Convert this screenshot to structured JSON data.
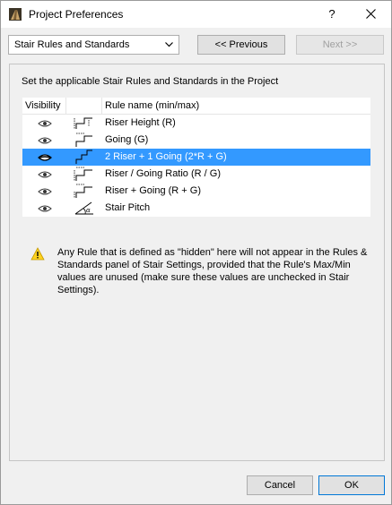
{
  "window": {
    "title": "Project Preferences",
    "help": "?",
    "close": "✕"
  },
  "toolbar": {
    "section": "Stair Rules and Standards",
    "prev_label": "<< Previous",
    "next_label": "Next >>"
  },
  "panel": {
    "heading": "Set the applicable Stair Rules and Standards in the Project",
    "columns": {
      "visibility": "Visibility",
      "name": "Rule name (min/max)"
    },
    "rows": [
      {
        "label": "Riser Height (R)",
        "selected": false
      },
      {
        "label": "Going (G)",
        "selected": false
      },
      {
        "label": "2 Riser + 1 Going (2*R + G)",
        "selected": true
      },
      {
        "label": "Riser / Going Ratio (R / G)",
        "selected": false
      },
      {
        "label": "Riser + Going (R + G)",
        "selected": false
      },
      {
        "label": "Stair Pitch",
        "selected": false
      }
    ],
    "warning": "Any Rule that is defined as \"hidden\" here will not appear in the Rules & Standards panel of Stair Settings, provided that the Rule's Max/Min values are unused (make sure these values are unchecked in Stair Settings)."
  },
  "footer": {
    "cancel_label": "Cancel",
    "ok_label": "OK"
  }
}
